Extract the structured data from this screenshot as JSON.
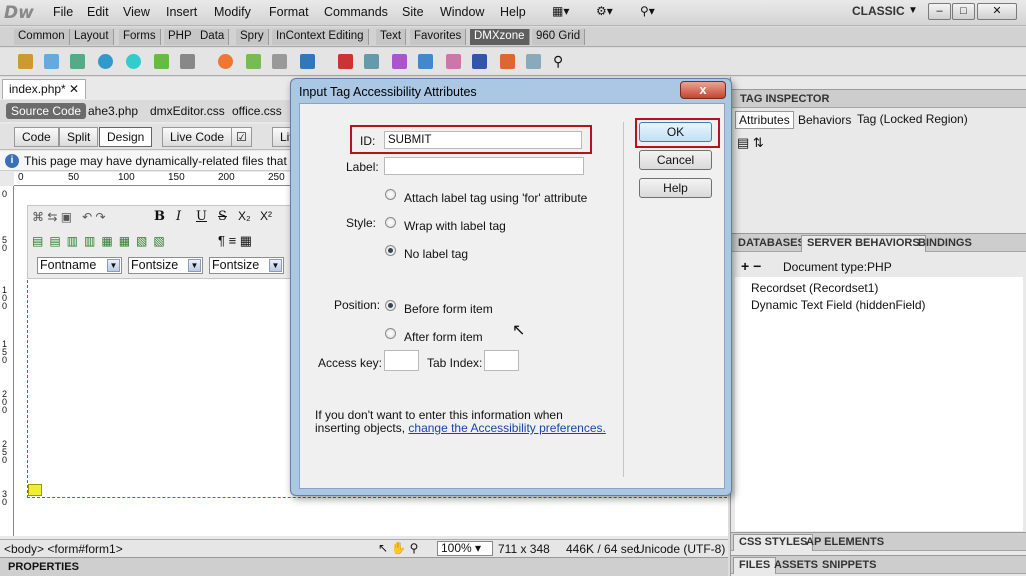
{
  "app": {
    "logo": "Dw",
    "workspace": "CLASSIC"
  },
  "menu": [
    "File",
    "Edit",
    "View",
    "Insert",
    "Modify",
    "Format",
    "Commands",
    "Site",
    "Window",
    "Help"
  ],
  "insert_tabs": [
    "Common",
    "Layout",
    "Forms",
    "PHP",
    "Data",
    "Spry",
    "InContext Editing",
    "Text",
    "Favorites",
    "DMXzone",
    "960 Grid"
  ],
  "insert_active": "DMXzone",
  "document": {
    "tab": "index.php*",
    "source_code": "Source Code",
    "related_files": [
      "ahe3.php",
      "dmxEditor.css",
      "office.css"
    ],
    "views": [
      "Code",
      "Split",
      "Design",
      "Live Code"
    ],
    "active_view": "Design",
    "live": "Liv",
    "info_text": "This page may have dynamically-related files that can o",
    "ruler": [
      "0",
      "50",
      "100",
      "150",
      "200",
      "250"
    ],
    "vruler": [
      "0",
      "5 0",
      "1 0 0",
      "1 5 0",
      "2 0 0",
      "2 5 0",
      "3 0"
    ],
    "font_selects": [
      "Fontname",
      "Fontsize",
      "Fontsize"
    ]
  },
  "status": {
    "tag_path": "<body> <form#form1>",
    "zoom": "100%",
    "size": "711 x 348",
    "weight": "446K / 64 sec",
    "encoding": "Unicode (UTF-8)"
  },
  "properties_label": "PROPERTIES",
  "panels": {
    "tag_inspector": {
      "title": "TAG INSPECTOR",
      "tabs": [
        "Attributes",
        "Behaviors"
      ],
      "active": "Attributes",
      "extra": "Tag (Locked Region)"
    },
    "server": {
      "tabs": [
        "DATABASES",
        "SERVER BEHAVIORS",
        "BINDINGS"
      ],
      "active": "SERVER BEHAVIORS",
      "doc_type": "Document type:PHP",
      "items": [
        "Recordset (Recordset1)",
        "Dynamic Text Field (hiddenField)"
      ]
    },
    "css": {
      "tabs": [
        "CSS STYLES",
        "AP ELEMENTS"
      ]
    },
    "files": {
      "tabs": [
        "FILES",
        "ASSETS",
        "SNIPPETS"
      ]
    }
  },
  "dialog": {
    "title": "Input Tag Accessibility Attributes",
    "close": "x",
    "id_label": "ID:",
    "id_value": "SUBMIT",
    "label_label": "Label:",
    "label_value": "",
    "style_label": "Style:",
    "style_options": [
      "Attach label tag using 'for' attribute",
      "Wrap with label tag",
      "No label tag"
    ],
    "style_selected": 2,
    "position_label": "Position:",
    "position_options": [
      "Before form item",
      "After form item"
    ],
    "position_selected": 0,
    "access_key_label": "Access key:",
    "tab_index_label": "Tab Index:",
    "note": "If you don't want to enter this information when",
    "note2": "inserting objects,",
    "note_link": "change the Accessibility preferences.",
    "ok": "OK",
    "cancel": "Cancel",
    "help": "Help"
  },
  "colors": {
    "highlight": "#b5121b",
    "link": "#1a44a8"
  }
}
